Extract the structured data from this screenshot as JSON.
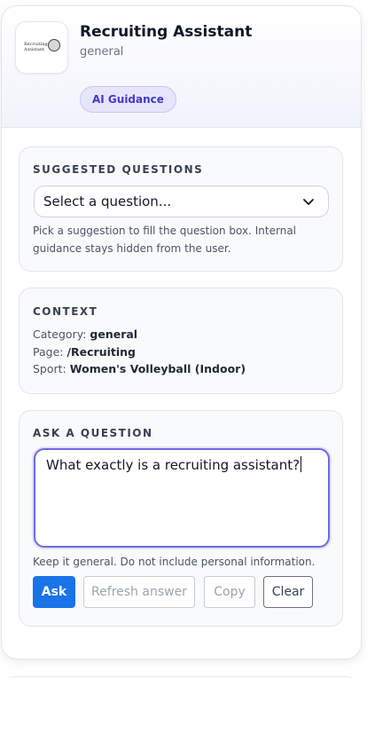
{
  "header": {
    "logo_text": "Recruiting Assistant",
    "title": "Recruiting Assistant",
    "subtitle": "general",
    "badge": "AI Guidance"
  },
  "suggested": {
    "heading": "SUGGESTED QUESTIONS",
    "select_value": "Select a question...",
    "help_line1": "Pick a suggestion to fill the question box. Internal",
    "help_line2": "guidance stays hidden from the user."
  },
  "context": {
    "heading": "CONTEXT",
    "category_label": "Category:",
    "category_value": "general",
    "page_label": "Page:",
    "page_value": "/Recruiting",
    "sport_label": "Sport:",
    "sport_value": "Women's Volleyball (Indoor)"
  },
  "ask": {
    "heading": "ASK A QUESTION",
    "question_value": "What exactly is a recruiting assistant?",
    "note": "Keep it general. Do not include personal information.",
    "ask_label": "Ask",
    "refresh_label": "Refresh answer",
    "copy_label": "Copy",
    "clear_label": "Clear"
  },
  "icons": {
    "chevron": "chevron-down-icon",
    "logo": "seal-logo-icon"
  },
  "colors": {
    "accent": "#1a73e8",
    "focus_ring": "#6d6ae0",
    "badge_bg": "#e6e6fb",
    "badge_text": "#4338ca"
  }
}
